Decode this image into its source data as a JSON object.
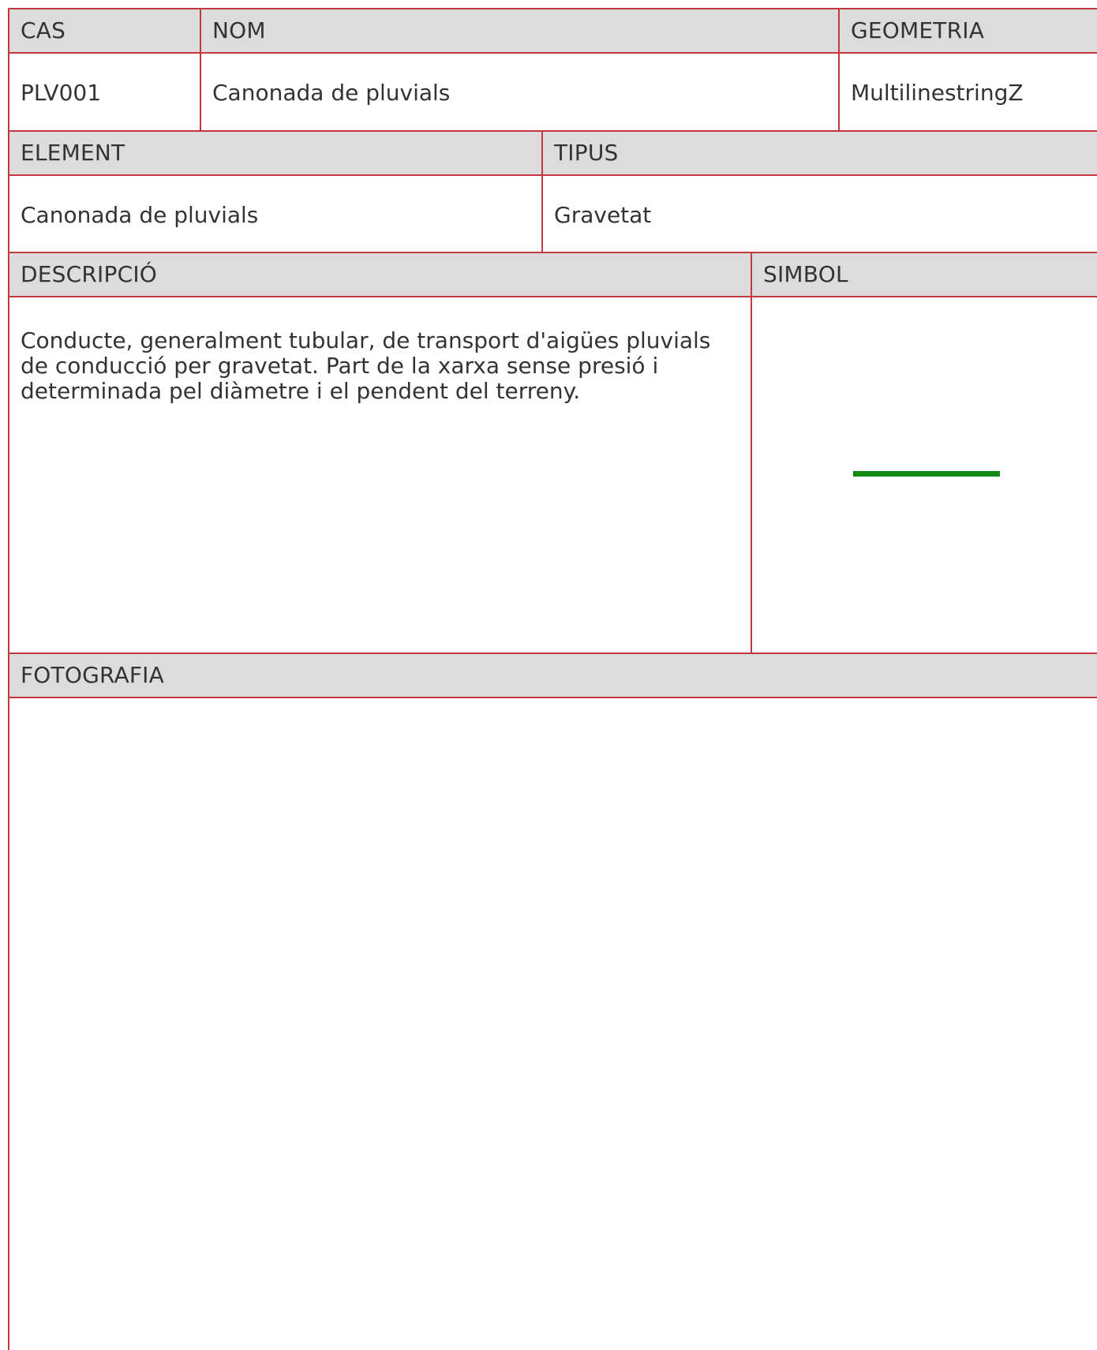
{
  "row1": {
    "headers": {
      "cas": "CAS",
      "nom": "NOM",
      "geometria": "GEOMETRIA"
    },
    "values": {
      "cas": "PLV001",
      "nom": "Canonada de pluvials",
      "geometria": "MultilinestringZ"
    }
  },
  "row2": {
    "headers": {
      "element": "ELEMENT",
      "tipus": "TIPUS"
    },
    "values": {
      "element": "Canonada de pluvials",
      "tipus": "Gravetat"
    }
  },
  "row3": {
    "headers": {
      "descripcio": "DESCRIPCIÓ",
      "simbol": "SIMBOL"
    },
    "descripcio": "Conducte, generalment tubular, de transport d'aigües pluvials de conducció per gravetat.  Part de la xarxa sense presió i determinada pel diàmetre i el pendent del terreny.",
    "simbol": {
      "icon": "green-line-symbol-icon",
      "color": "#138a13"
    }
  },
  "row4": {
    "headers": {
      "fotografia": "FOTOGRAFIA"
    }
  },
  "colors": {
    "border": "#c0393f",
    "header_bg": "#dcdcdc",
    "text": "#333333"
  }
}
